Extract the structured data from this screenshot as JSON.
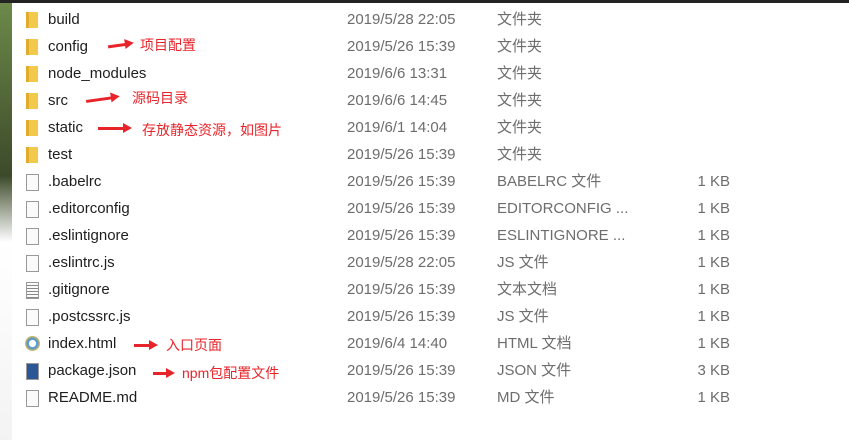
{
  "files": [
    {
      "name": "build",
      "date": "2019/5/28 22:05",
      "type": "文件夹",
      "size": "",
      "icon": "folder-icon"
    },
    {
      "name": "config",
      "date": "2019/5/26 15:39",
      "type": "文件夹",
      "size": "",
      "icon": "folder-icon"
    },
    {
      "name": "node_modules",
      "date": "2019/6/6 13:31",
      "type": "文件夹",
      "size": "",
      "icon": "folder-icon"
    },
    {
      "name": "src",
      "date": "2019/6/6 14:45",
      "type": "文件夹",
      "size": "",
      "icon": "folder-icon"
    },
    {
      "name": "static",
      "date": "2019/6/1 14:04",
      "type": "文件夹",
      "size": "",
      "icon": "folder-icon"
    },
    {
      "name": "test",
      "date": "2019/5/26 15:39",
      "type": "文件夹",
      "size": "",
      "icon": "folder-icon"
    },
    {
      "name": ".babelrc",
      "date": "2019/5/26 15:39",
      "type": "BABELRC 文件",
      "size": "1 KB",
      "icon": "file-icon"
    },
    {
      "name": ".editorconfig",
      "date": "2019/5/26 15:39",
      "type": "EDITORCONFIG ...",
      "size": "1 KB",
      "icon": "file-icon"
    },
    {
      "name": ".eslintignore",
      "date": "2019/5/26 15:39",
      "type": "ESLINTIGNORE ...",
      "size": "1 KB",
      "icon": "file-icon"
    },
    {
      "name": ".eslintrc.js",
      "date": "2019/5/28 22:05",
      "type": "JS 文件",
      "size": "1 KB",
      "icon": "file-icon"
    },
    {
      "name": ".gitignore",
      "date": "2019/5/26 15:39",
      "type": "文本文档",
      "size": "1 KB",
      "icon": "text-document-icon"
    },
    {
      "name": ".postcssrc.js",
      "date": "2019/5/26 15:39",
      "type": "JS 文件",
      "size": "1 KB",
      "icon": "file-icon"
    },
    {
      "name": "index.html",
      "date": "2019/6/4 14:40",
      "type": "HTML 文档",
      "size": "1 KB",
      "icon": "ie-html-icon"
    },
    {
      "name": "package.json",
      "date": "2019/5/26 15:39",
      "type": "JSON 文件",
      "size": "3 KB",
      "icon": "word-document-icon"
    },
    {
      "name": "README.md",
      "date": "2019/5/26 15:39",
      "type": "MD 文件",
      "size": "1 KB",
      "icon": "file-icon"
    }
  ],
  "annotations": {
    "config": "项目配置",
    "src": "源码目录",
    "static": "存放静态资源，如图片",
    "index": "入口页面",
    "package": "npm包配置文件"
  },
  "colors": {
    "annotation": "#e8242b"
  }
}
